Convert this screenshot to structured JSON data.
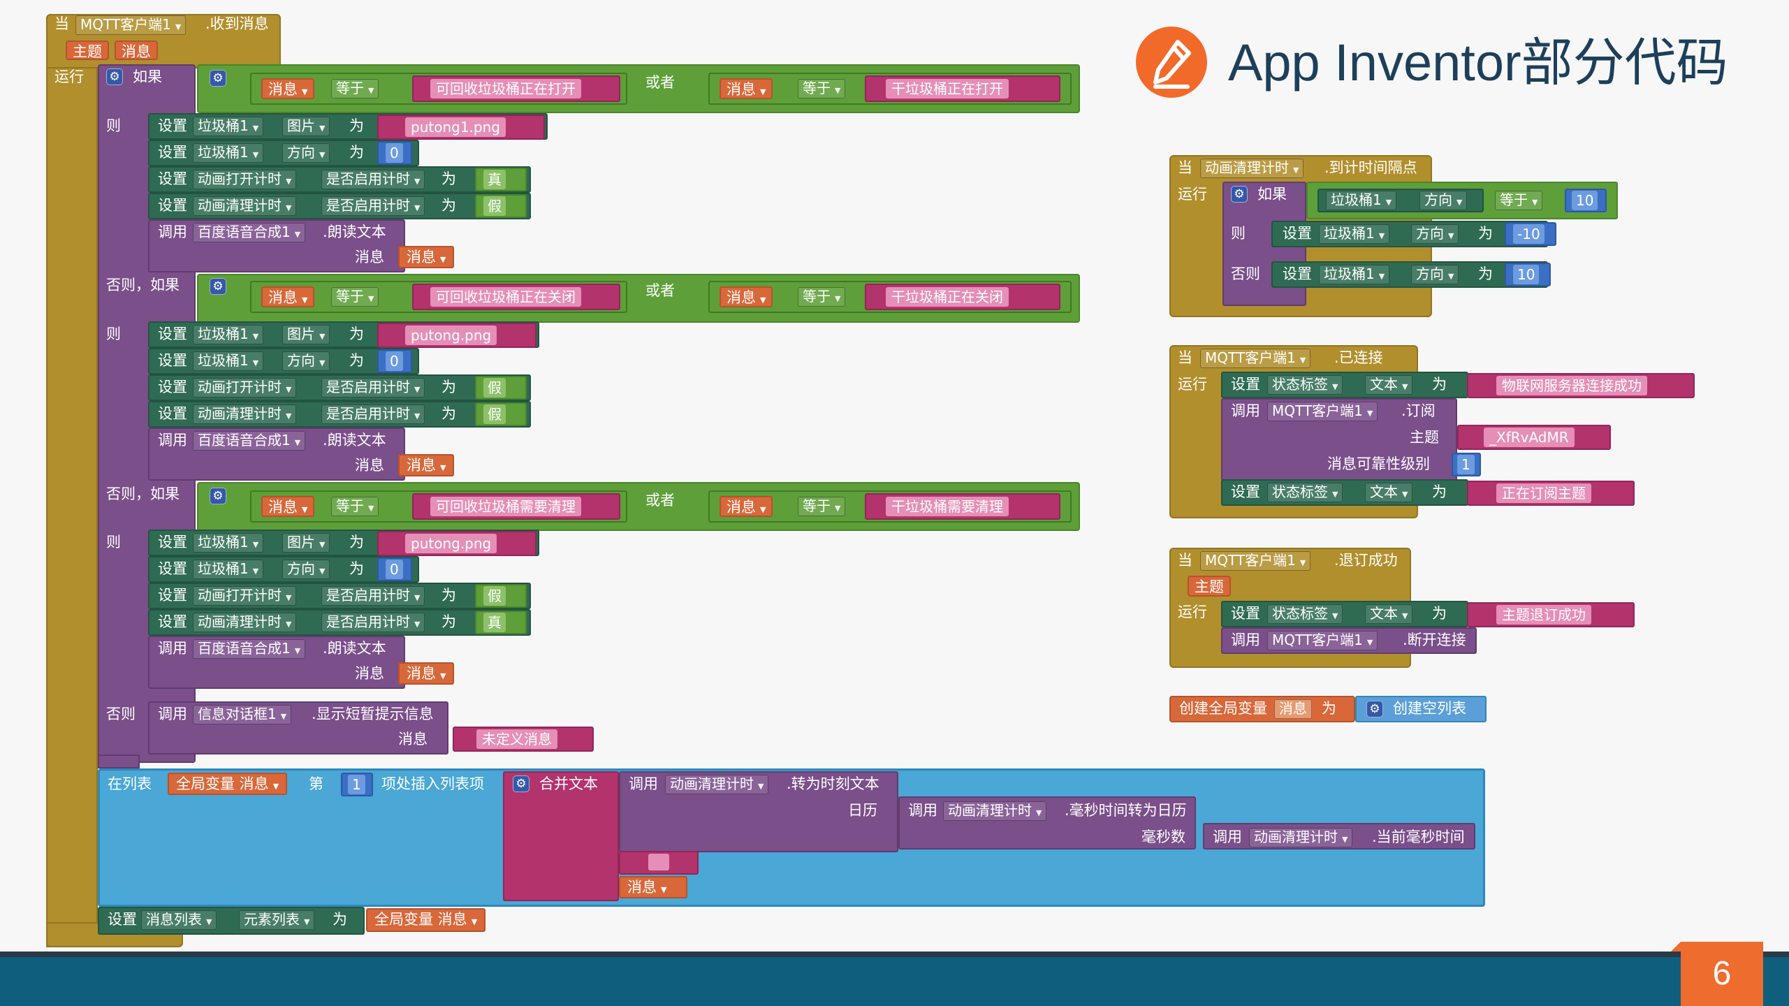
{
  "slide": {
    "title": "App Inventor部分代码",
    "page_number": "6",
    "colors": {
      "accent": "#f26a2a",
      "footer": "#0f5e7e",
      "title": "#1d3f5a"
    }
  },
  "labels": {
    "when": "当",
    "received": ".收到消息",
    "topic": "主题",
    "message": "消息",
    "run": "运行",
    "if": "如果",
    "then": "则",
    "elseif": "否则，如果",
    "else": "否则",
    "set": "设置",
    "to": "为",
    "call": "调用",
    "equals": "等于",
    "or": "或者",
    "image": "图片",
    "heading": "方向",
    "enabled": "是否启用计时",
    "speak": ".朗读文本",
    "true": "真",
    "false": "假",
    "show_alert": ".显示短暂提示信息",
    "in_list": "在列表",
    "index": "第",
    "insert_item": "项处插入列表项",
    "join": "合并文本",
    "format_time": ".转为时刻文本",
    "calendar": "日历",
    "ms_to_cal": ".毫秒时间转为日历",
    "millis": "毫秒数",
    "now_ms": ".当前毫秒时间",
    "elements": "元素列表",
    "global_msg": "全局变量 消息",
    "timer": ".到计时间隔点",
    "connected": ".已连接",
    "text": "文本",
    "subscribe": ".订阅",
    "qos": "消息可靠性级别",
    "unsub_ok": ".退订成功",
    "disconnect": ".断开连接",
    "init_global": "创建全局变量",
    "create_empty": "创建空列表"
  },
  "components": {
    "mqtt": "MQTT客户端1",
    "bin": "垃圾桶1",
    "anim_open": "动画打开计时",
    "anim_clean": "动画清理计时",
    "tts": "百度语音合成1",
    "notifier": "信息对话框1",
    "msg_list": "消息列表",
    "status": "状态标签"
  },
  "strings": {
    "recyclable_open": "可回收垃圾桶正在打开",
    "dry_open": "干垃圾桶正在打开",
    "recyclable_close": "可回收垃圾桶正在关闭",
    "dry_close": "干垃圾桶正在关闭",
    "recyclable_full": "可回收垃圾桶需要清理",
    "dry_full": "干垃圾桶需要清理",
    "img1": "putong1.png",
    "img2": "putong.png",
    "undefined": "未定义消息",
    "iot_ok": "物联网服务器连接成功",
    "topic_id": "_XfRvAdMR",
    "subscribing": "正在订阅主题",
    "unsub_done": "主题退订成功"
  },
  "numbers": {
    "zero": "0",
    "ten": "10",
    "neg_ten": "-10",
    "one": "1"
  }
}
